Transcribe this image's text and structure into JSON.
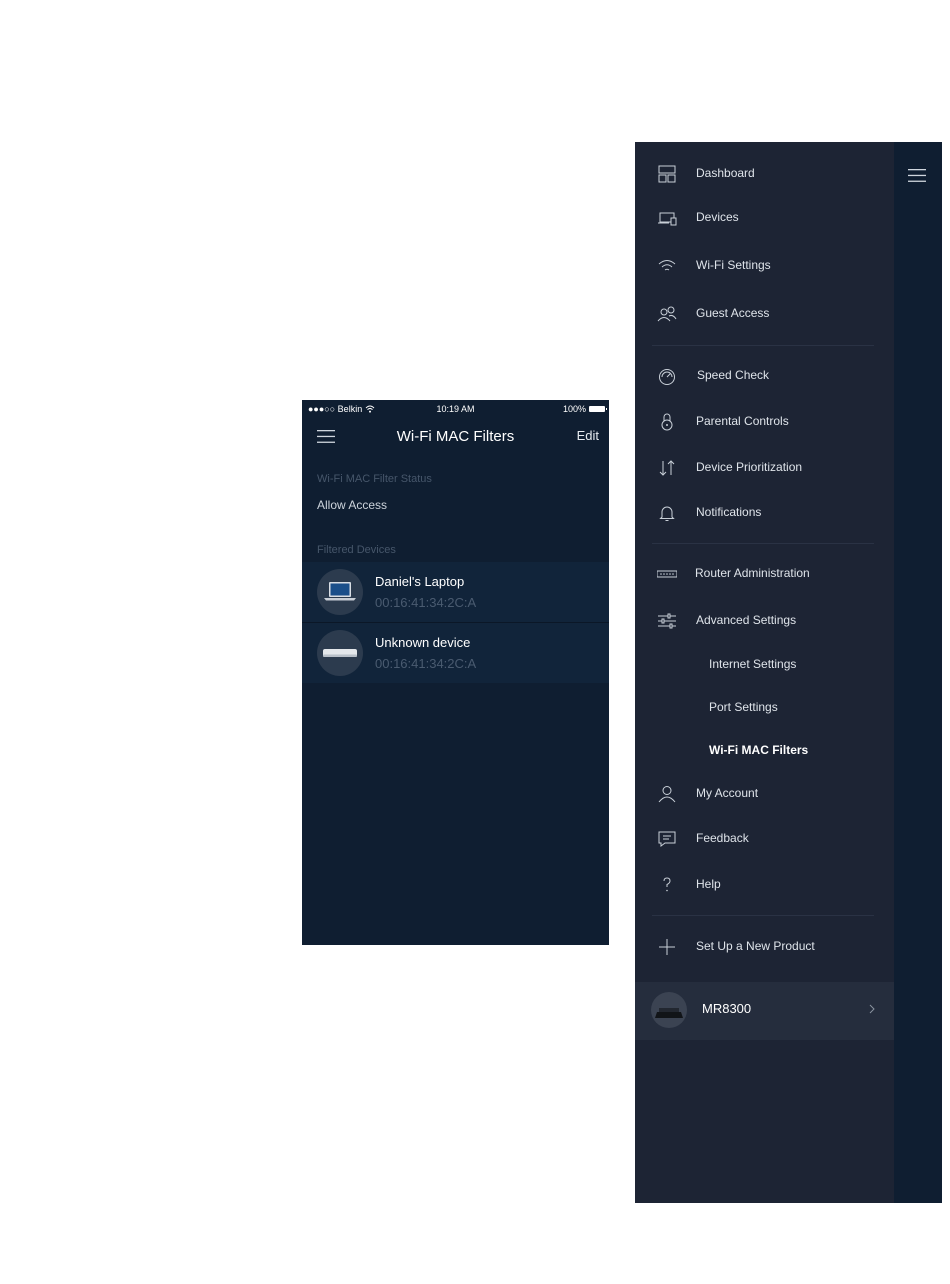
{
  "phone": {
    "status": {
      "carrier": "●●●○○ Belkin",
      "time": "10:19 AM",
      "battery": "100%"
    },
    "title": "Wi-Fi MAC Filters",
    "edit_label": "Edit",
    "filter_status_label": "Wi-Fi MAC Filter Status",
    "filter_status_value": "Allow Access",
    "filtered_devices_label": "Filtered Devices",
    "devices": [
      {
        "name": "Daniel's Laptop",
        "mac": "00:16:41:34:2C:A"
      },
      {
        "name": "Unknown device",
        "mac": "00:16:41:34:2C:A"
      }
    ]
  },
  "menu": {
    "items": [
      {
        "label": "Dashboard",
        "icon": "dashboard-icon"
      },
      {
        "label": "Devices",
        "icon": "devices-icon"
      },
      {
        "label": "Wi-Fi Settings",
        "icon": "wifi-icon"
      },
      {
        "label": "Guest Access",
        "icon": "guest-access-icon"
      },
      {
        "label": "Speed Check",
        "icon": "speedometer-icon"
      },
      {
        "label": "Parental Controls",
        "icon": "lock-icon"
      },
      {
        "label": "Device Prioritization",
        "icon": "up-down-arrows-icon"
      },
      {
        "label": "Notifications",
        "icon": "bell-icon"
      },
      {
        "label": "Router Administration",
        "icon": "router-icon"
      },
      {
        "label": "Advanced Settings",
        "icon": "sliders-icon"
      },
      {
        "label": "My Account",
        "icon": "user-icon"
      },
      {
        "label": "Feedback",
        "icon": "chat-icon"
      },
      {
        "label": "Help",
        "icon": "question-icon"
      },
      {
        "label": "Set Up a New Product",
        "icon": "plus-icon"
      }
    ],
    "advanced_sub": [
      "Internet Settings",
      "Port Settings",
      "Wi-Fi MAC Filters"
    ],
    "product_name": "MR8300"
  },
  "colors": {
    "phone_bg": "#0f1e31",
    "drawer_bg": "#1d2434",
    "row_bg": "#11243a"
  }
}
